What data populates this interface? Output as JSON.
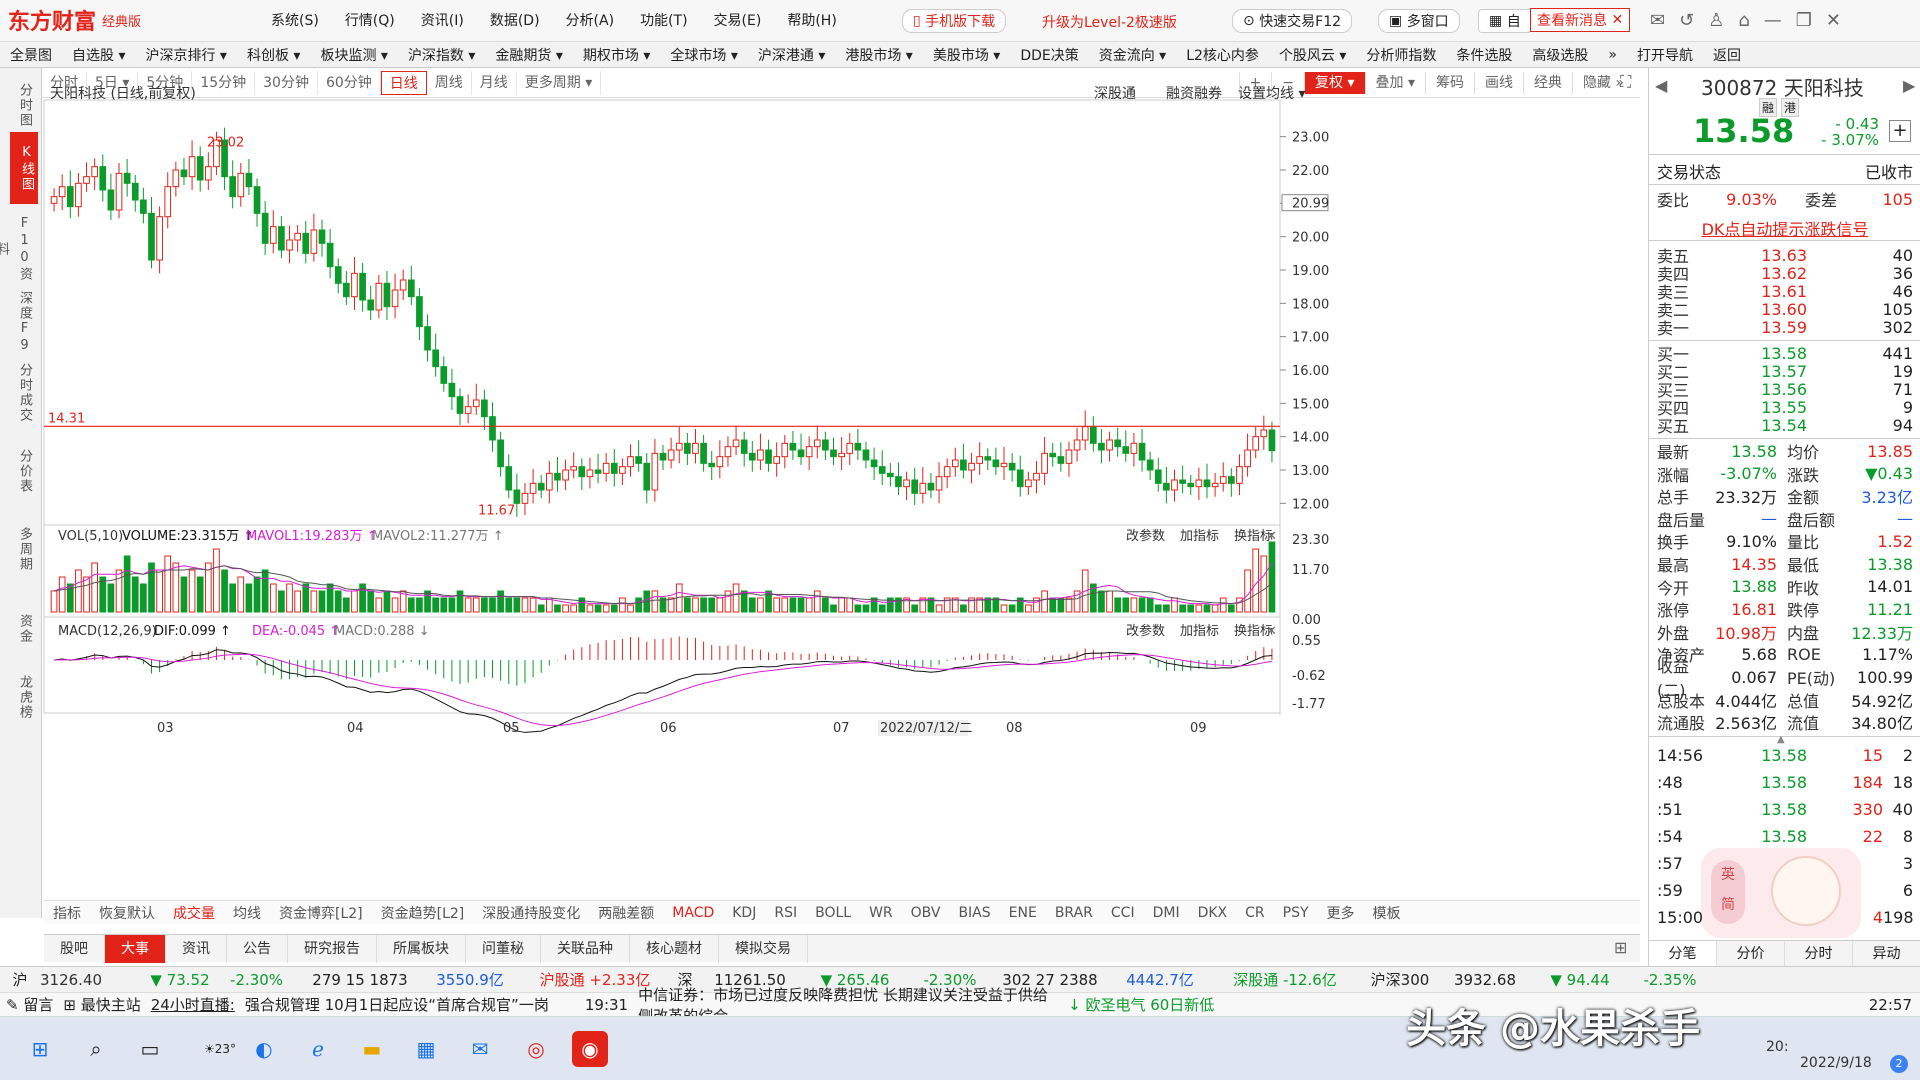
{
  "app": {
    "logo": "东方财富",
    "edition": "经典版"
  },
  "menu": [
    "系统(S)",
    "行情(Q)",
    "资讯(I)",
    "数据(D)",
    "分析(A)",
    "功能(T)",
    "交易(E)",
    "帮助(H)"
  ],
  "top_buttons": {
    "mobile": "手机版下载",
    "upgrade": "升级为Level-2极速版",
    "fast_trade": "快速交易F12",
    "multi": "多窗口",
    "self": "自",
    "news": "查看新消息"
  },
  "navbar": [
    "全景图",
    "自选股 ▾",
    "沪深京排行 ▾",
    "科创板 ▾",
    "板块监测 ▾",
    "沪深指数 ▾",
    "金融期货 ▾",
    "期权市场 ▾",
    "全球市场 ▾",
    "沪深港通 ▾",
    "港股市场 ▾",
    "美股市场 ▾",
    "DDE决策",
    "资金流向 ▾",
    "L2核心内参",
    "个股风云 ▾",
    "分析师指数",
    "条件选股",
    "高级选股",
    "»",
    "打开导航",
    "返回"
  ],
  "leftbar": [
    "分时图",
    "K线图",
    "F10资料",
    "深度F9",
    "分时成交",
    "分价表",
    "多周期",
    "资金",
    "龙虎榜"
  ],
  "periods": [
    "分时",
    "5日 ▾",
    "5分钟",
    "15分钟",
    "30分钟",
    "60分钟",
    "日线",
    "周线",
    "月线",
    "更多周期 ▾"
  ],
  "right_tools": [
    "+",
    "−",
    "复权 ▾",
    "叠加 ▾",
    "筹码",
    "画线",
    "经典",
    "隐藏 »"
  ],
  "chart_title": "天阳科技 (日线,前复权)",
  "chart_links": [
    "深股通",
    "融资融券",
    "设置均线 ▾"
  ],
  "vol_legend": {
    "label": "VOL(5,10)",
    "volume": "VOLUME:23.315万 ↑",
    "mavol1": "MAVOL1:19.283万 ↑",
    "mavol2": "MAVOL2:11.277万 ↑"
  },
  "macd_legend": {
    "label": "MACD(12,26,9)",
    "dif": "DIF:0.099 ↑",
    "dea": "DEA:-0.045 ↑",
    "macd": "MACD:0.288 ↓"
  },
  "panel_links": [
    "改参数",
    "加指标",
    "换指标"
  ],
  "annotations": {
    "high": "23.02",
    "low": "11.67",
    "hline": "14.31",
    "price_tag": "20.99",
    "date_tag": "2022/07/12/二"
  },
  "chart_data": {
    "type": "candlestick",
    "ylim": [
      11.5,
      23.2
    ],
    "yticks": [
      "23.00",
      "22.00",
      "21.00",
      "20.00",
      "19.00",
      "18.00",
      "17.00",
      "16.00",
      "15.00",
      "14.00",
      "13.00",
      "12.00"
    ],
    "xticks": [
      "03",
      "04",
      "05",
      "06",
      "07",
      "08",
      "09"
    ],
    "vol_ticks": [
      "23.30",
      "11.70",
      "0.00"
    ],
    "macd_ticks": [
      "0.55",
      "-0.62",
      "-1.77"
    ],
    "close": [
      21.2,
      21.5,
      20.9,
      21.6,
      21.8,
      22.1,
      21.4,
      20.8,
      21.9,
      21.6,
      21.1,
      20.7,
      19.3,
      20.6,
      21.5,
      22.0,
      21.8,
      22.4,
      21.7,
      22.1,
      22.9,
      21.8,
      21.2,
      21.9,
      21.5,
      20.7,
      19.8,
      20.3,
      19.6,
      19.9,
      20.1,
      19.5,
      20.2,
      19.8,
      19.1,
      18.6,
      18.2,
      18.9,
      18.1,
      17.8,
      18.6,
      17.9,
      18.4,
      18.7,
      18.2,
      17.3,
      16.6,
      16.1,
      15.6,
      15.2,
      14.7,
      14.9,
      15.1,
      14.6,
      13.9,
      13.1,
      12.4,
      12.0,
      12.3,
      12.6,
      12.4,
      12.9,
      12.7,
      13.0,
      13.1,
      12.8,
      13.0,
      12.9,
      13.2,
      12.9,
      13.1,
      13.4,
      13.2,
      12.4,
      13.5,
      13.3,
      13.6,
      13.8,
      13.5,
      13.8,
      13.2,
      13.1,
      13.4,
      13.7,
      13.9,
      13.5,
      13.3,
      13.6,
      13.2,
      13.4,
      13.8,
      13.6,
      13.4,
      13.7,
      13.9,
      13.6,
      13.4,
      13.5,
      13.8,
      13.6,
      13.3,
      13.1,
      12.9,
      12.8,
      12.5,
      12.7,
      12.3,
      12.6,
      12.4,
      12.8,
      13.1,
      13.3,
      13.0,
      13.2,
      13.4,
      13.3,
      13.1,
      13.2,
      13.0,
      12.5,
      12.7,
      12.9,
      13.5,
      13.4,
      13.2,
      13.6,
      13.9,
      14.3,
      13.8,
      13.6,
      13.9,
      13.7,
      13.5,
      13.8,
      13.3,
      13.0,
      12.6,
      12.4,
      12.7,
      12.6,
      12.5,
      12.7,
      12.5,
      12.6,
      12.8,
      12.6,
      13.1,
      13.6,
      14.0,
      14.2,
      13.58
    ],
    "volume_norm": [
      0.3,
      0.5,
      0.4,
      0.6,
      0.5,
      0.7,
      0.5,
      0.4,
      0.6,
      0.8,
      0.5,
      0.4,
      0.7,
      0.6,
      0.8,
      0.7,
      0.5,
      0.6,
      0.5,
      0.7,
      0.9,
      0.6,
      0.4,
      0.5,
      0.4,
      0.5,
      0.6,
      0.4,
      0.3,
      0.4,
      0.3,
      0.4,
      0.3,
      0.3,
      0.4,
      0.3,
      0.2,
      0.3,
      0.4,
      0.3,
      0.2,
      0.3,
      0.2,
      0.3,
      0.2,
      0.2,
      0.3,
      0.2,
      0.2,
      0.2,
      0.3,
      0.2,
      0.2,
      0.2,
      0.2,
      0.3,
      0.2,
      0.2,
      0.2,
      0.2,
      0.1,
      0.2,
      0.1,
      0.1,
      0.1,
      0.2,
      0.1,
      0.1,
      0.1,
      0.1,
      0.2,
      0.1,
      0.2,
      0.3,
      0.3,
      0.2,
      0.2,
      0.4,
      0.2,
      0.2,
      0.2,
      0.2,
      0.2,
      0.3,
      0.4,
      0.3,
      0.2,
      0.2,
      0.3,
      0.2,
      0.2,
      0.2,
      0.2,
      0.2,
      0.3,
      0.2,
      0.1,
      0.2,
      0.2,
      0.1,
      0.1,
      0.2,
      0.1,
      0.2,
      0.2,
      0.2,
      0.1,
      0.2,
      0.2,
      0.1,
      0.2,
      0.2,
      0.1,
      0.2,
      0.2,
      0.2,
      0.2,
      0.1,
      0.1,
      0.2,
      0.1,
      0.2,
      0.3,
      0.2,
      0.2,
      0.2,
      0.3,
      0.6,
      0.4,
      0.3,
      0.3,
      0.2,
      0.2,
      0.2,
      0.2,
      0.2,
      0.1,
      0.1,
      0.2,
      0.1,
      0.1,
      0.1,
      0.1,
      0.1,
      0.2,
      0.1,
      0.2,
      0.6,
      0.9,
      0.8,
      1.0
    ]
  },
  "quote": {
    "code": "300872",
    "name": "天阳科技",
    "tags": [
      "融",
      "港"
    ],
    "price": "13.58",
    "change": "- 0.43",
    "pct": "- 3.07%",
    "status_label": "交易状态",
    "status": "已收市",
    "webi_label": "委比",
    "webi": "9.03%",
    "weicha_label": "委差",
    "weicha": "105",
    "signal": "DK点自动提示涨跌信号"
  },
  "asks": [
    {
      "l": "卖五",
      "p": "13.63",
      "v": "40"
    },
    {
      "l": "卖四",
      "p": "13.62",
      "v": "36"
    },
    {
      "l": "卖三",
      "p": "13.61",
      "v": "46"
    },
    {
      "l": "卖二",
      "p": "13.60",
      "v": "105"
    },
    {
      "l": "卖一",
      "p": "13.59",
      "v": "302"
    }
  ],
  "bids": [
    {
      "l": "买一",
      "p": "13.58",
      "v": "441"
    },
    {
      "l": "买二",
      "p": "13.57",
      "v": "19"
    },
    {
      "l": "买三",
      "p": "13.56",
      "v": "71"
    },
    {
      "l": "买四",
      "p": "13.55",
      "v": "9"
    },
    {
      "l": "买五",
      "p": "13.54",
      "v": "94"
    }
  ],
  "stats": [
    {
      "a": "最新",
      "b": "13.58",
      "bc": "green",
      "c": "均价",
      "d": "13.85",
      "dc": "red"
    },
    {
      "a": "涨幅",
      "b": "-3.07%",
      "bc": "green",
      "c": "涨跌",
      "d": "▼0.43",
      "dc": "green"
    },
    {
      "a": "总手",
      "b": "23.32万",
      "bc": "",
      "c": "金额",
      "d": "3.23亿",
      "dc": "blue"
    },
    {
      "a": "盘后量",
      "b": "—",
      "bc": "blue",
      "c": "盘后额",
      "d": "—",
      "dc": "blue"
    },
    {
      "a": "换手",
      "b": "9.10%",
      "bc": "",
      "c": "量比",
      "d": "1.52",
      "dc": "red"
    },
    {
      "a": "最高",
      "b": "14.35",
      "bc": "red",
      "c": "最低",
      "d": "13.38",
      "dc": "green"
    },
    {
      "a": "今开",
      "b": "13.88",
      "bc": "green",
      "c": "昨收",
      "d": "14.01",
      "dc": ""
    },
    {
      "a": "涨停",
      "b": "16.81",
      "bc": "red",
      "c": "跌停",
      "d": "11.21",
      "dc": "green"
    },
    {
      "a": "外盘",
      "b": "10.98万",
      "bc": "red",
      "c": "内盘",
      "d": "12.33万",
      "dc": "green"
    },
    {
      "a": "净资产",
      "b": "5.68",
      "bc": "",
      "c": "ROE",
      "d": "1.17%",
      "dc": ""
    },
    {
      "a": "收益(二)",
      "b": "0.067",
      "bc": "",
      "c": "PE(动)",
      "d": "100.99",
      "dc": ""
    },
    {
      "a": "总股本",
      "b": "4.044亿",
      "bc": "",
      "c": "总值",
      "d": "54.92亿",
      "dc": ""
    },
    {
      "a": "流通股",
      "b": "2.563亿",
      "bc": "",
      "c": "流值",
      "d": "34.80亿",
      "dc": ""
    }
  ],
  "ticks": [
    {
      "t": "14:56",
      "p": "13.58",
      "v": "15",
      "n": "2"
    },
    {
      "t": ":48",
      "p": "13.58",
      "v": "184",
      "n": "18"
    },
    {
      "t": ":51",
      "p": "13.58",
      "v": "330",
      "n": "40"
    },
    {
      "t": ":54",
      "p": "13.58",
      "v": "22",
      "n": "8"
    },
    {
      "t": ":57",
      "p": "",
      "v": "",
      "n": "3"
    },
    {
      "t": ":59",
      "p": "",
      "v": "",
      "n": "6"
    },
    {
      "t": "15:00",
      "p": "",
      "v": "4",
      "n": "198"
    }
  ],
  "right_tabs": [
    "分笔",
    "分价",
    "分时",
    "异动"
  ],
  "indicators": [
    "指标",
    "恢复默认",
    "成交量",
    "均线",
    "资金博弈[L2]",
    "资金趋势[L2]",
    "深股通持股变化",
    "两融差额",
    "MACD",
    "KDJ",
    "RSI",
    "BOLL",
    "WR",
    "OBV",
    "BIAS",
    "ENE",
    "BRAR",
    "CCI",
    "DMI",
    "DKX",
    "CR",
    "PSY",
    "更多",
    "模板"
  ],
  "bottom_tabs": [
    "股吧",
    "大事",
    "资讯",
    "公告",
    "研究报告",
    "所属板块",
    "问董秘",
    "关联品种",
    "核心题材",
    "模拟交易"
  ],
  "status": {
    "sh": "沪",
    "sh_val": "3126.40",
    "sh_chg": "▼ 73.52",
    "sh_pct": "-2.30%",
    "sh_cnt": "279 15 1873",
    "sh_amt": "3550.9亿",
    "hgt": "沪股通 +2.33亿",
    "sz": "深",
    "sz_val": "11261.50",
    "sz_chg": "▼ 265.46",
    "sz_pct": "-2.30%",
    "sz_cnt": "302 27 2388",
    "sz_amt": "4442.7亿",
    "sgt": "深股通 -12.6亿",
    "hs300": "沪深300",
    "hs_val": "3932.68",
    "hs_chg": "▼ 94.44",
    "hs_pct": "-2.35%"
  },
  "news": {
    "msg": "留言",
    "main": "最快主站",
    "live": "24小时直播:",
    "text": "强合规管理 10月1日起应设“首席合规官”一岗",
    "time": "19:31",
    "item": "中信证券：市场已过度反映降费担忧 长期建议关注受益于供给侧改革的综合",
    "stock": "↓ 欧圣电气 60日新低",
    "clock": "22:57"
  },
  "taskbar": {
    "weather": "23°",
    "time": "20:",
    "date": "2022/9/18",
    "badge": "2"
  },
  "watermark": "头条 @水果杀手"
}
